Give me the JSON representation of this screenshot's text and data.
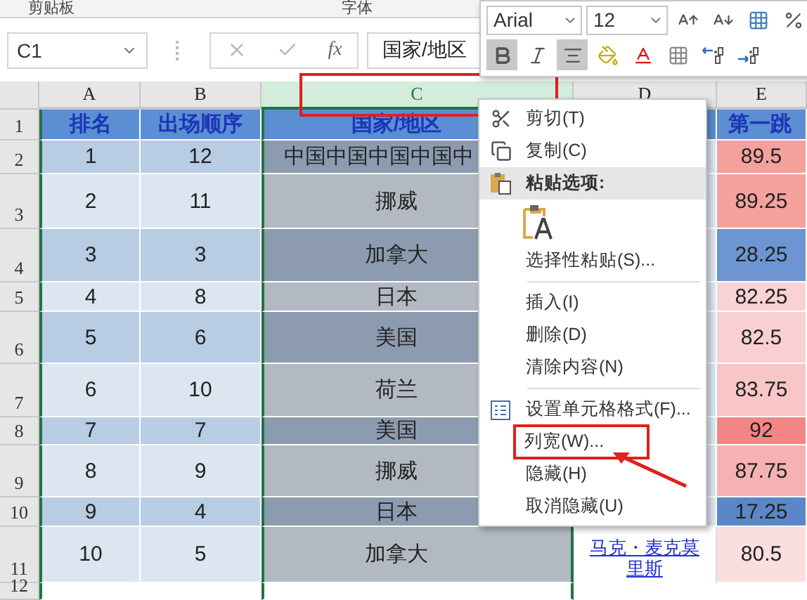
{
  "ribbon": {
    "groups": [
      "剪贴板",
      "字体"
    ]
  },
  "formula_bar": {
    "name_box": "C1",
    "fx": "fx",
    "formula": "国家/地区"
  },
  "mini_toolbar": {
    "font": "Arial",
    "size": "12",
    "buttons": [
      {
        "kind": "grow",
        "on": false
      },
      {
        "kind": "shrink",
        "on": false
      },
      {
        "kind": "format",
        "on": false
      },
      {
        "kind": "percent",
        "on": false
      },
      {
        "kind": "bold",
        "on": true
      },
      {
        "kind": "italic",
        "on": false
      },
      {
        "kind": "align",
        "on": true
      },
      {
        "kind": "fill",
        "on": false
      },
      {
        "kind": "fontcolor",
        "on": false
      },
      {
        "kind": "borders",
        "on": false
      },
      {
        "kind": "decinc",
        "on": false
      },
      {
        "kind": "decdec",
        "on": false
      }
    ]
  },
  "columns": [
    {
      "label": "A",
      "selected": false,
      "boxed": false
    },
    {
      "label": "B",
      "selected": false,
      "boxed": false
    },
    {
      "label": "C",
      "selected": true,
      "boxed": true
    },
    {
      "label": "D",
      "selected": false,
      "boxed": false
    },
    {
      "label": "E",
      "selected": false,
      "boxed": false
    }
  ],
  "rows": [
    {
      "number": "1",
      "kind": "header",
      "a": "排名",
      "b": "出场顺序",
      "c": "国家/地区",
      "e": {
        "value": "第一跳"
      }
    },
    {
      "number": "2",
      "shaded": true,
      "kind": "data",
      "a": "1",
      "b": "12",
      "c": "中国中国中国中国中",
      "e": {
        "value": "89.5",
        "color": "#f4a09c"
      }
    },
    {
      "number": "3",
      "shaded": false,
      "kind": "data",
      "a": "2",
      "b": "11",
      "c": "挪威",
      "e": {
        "value": "89.25",
        "color": "#f4a29e"
      }
    },
    {
      "number": "4",
      "shaded": true,
      "kind": "data",
      "a": "3",
      "b": "3",
      "c": "加拿大",
      "e": {
        "value": "28.25",
        "color": "#6c95d1"
      }
    },
    {
      "number": "5",
      "shaded": false,
      "kind": "data",
      "a": "4",
      "b": "8",
      "c": "日本",
      "e": {
        "value": "82.25",
        "color": "#f9d3d4"
      }
    },
    {
      "number": "6",
      "shaded": true,
      "kind": "data",
      "a": "5",
      "b": "6",
      "c": "美国",
      "e": {
        "value": "82.5",
        "color": "#f9d0d1"
      }
    },
    {
      "number": "7",
      "shaded": false,
      "kind": "data",
      "a": "6",
      "b": "10",
      "c": "荷兰",
      "e": {
        "value": "83.75",
        "color": "#f8c6c7"
      }
    },
    {
      "number": "8",
      "shaded": true,
      "kind": "data",
      "a": "7",
      "b": "7",
      "c": "美国",
      "e": {
        "value": "92",
        "color": "#f38584"
      }
    },
    {
      "number": "9",
      "shaded": false,
      "kind": "data",
      "a": "8",
      "b": "9",
      "c": "挪威",
      "e": {
        "value": "87.75",
        "color": "#f6b2b2"
      }
    },
    {
      "number": "10",
      "shaded": true,
      "kind": "data",
      "a": "9",
      "b": "4",
      "c": "日本",
      "e": {
        "value": "17.25",
        "color": "#5b87c9"
      }
    },
    {
      "number": "11",
      "shaded": false,
      "kind": "data",
      "a": "10",
      "b": "5",
      "c": "加拿大",
      "d": "马克・麦克莫里斯",
      "e": {
        "value": "80.5",
        "color": "#fbdfe0"
      }
    },
    {
      "number": "12",
      "kind": "empty"
    }
  ],
  "context_menu": [
    {
      "kind": "cut",
      "label": "剪切(T)",
      "highlighted": false,
      "boxed": false
    },
    {
      "kind": "copy",
      "label": "复制(C)",
      "highlighted": false,
      "boxed": false
    },
    {
      "kind": "paste-header",
      "label": "粘贴选项:",
      "highlighted": true,
      "boxed": false
    },
    {
      "kind": "paste-button"
    },
    {
      "kind": "plain",
      "label": "选择性粘贴(S)...",
      "highlighted": false,
      "boxed": false
    },
    {
      "kind": "separator"
    },
    {
      "kind": "plain",
      "label": "插入(I)",
      "highlighted": false,
      "boxed": false
    },
    {
      "kind": "plain",
      "label": "删除(D)",
      "highlighted": false,
      "boxed": false
    },
    {
      "kind": "plain",
      "label": "清除内容(N)",
      "highlighted": false,
      "boxed": false
    },
    {
      "kind": "separator"
    },
    {
      "kind": "format",
      "label": "设置单元格格式(F)...",
      "highlighted": false,
      "boxed": false
    },
    {
      "kind": "plain",
      "label": "列宽(W)...",
      "highlighted": false,
      "boxed": true
    },
    {
      "kind": "plain",
      "label": "隐藏(H)",
      "highlighted": false,
      "boxed": false
    },
    {
      "kind": "plain",
      "label": "取消隐藏(U)",
      "highlighted": false,
      "boxed": false
    }
  ]
}
